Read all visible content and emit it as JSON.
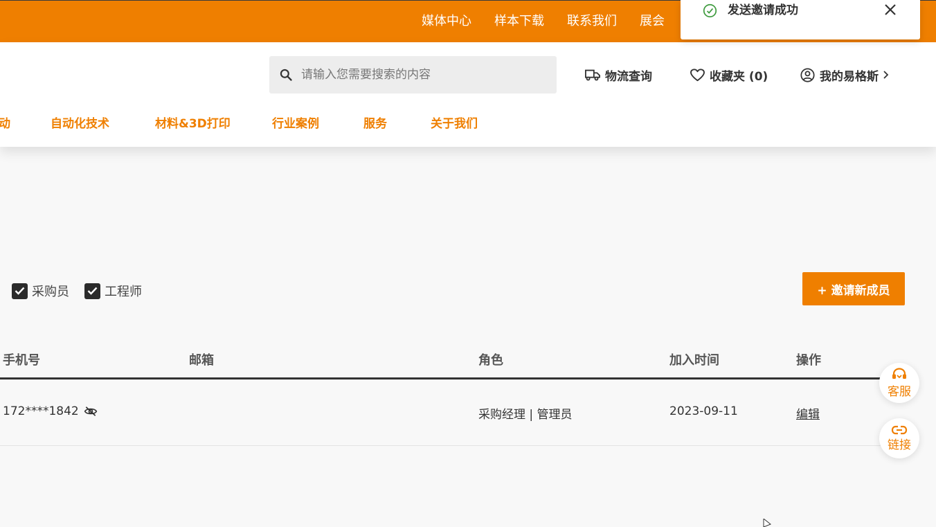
{
  "topbar": {
    "links": [
      "媒体中心",
      "样本下载",
      "联系我们",
      "展会"
    ]
  },
  "toast": {
    "message": "发送邀请成功",
    "icon": "check-circle-icon",
    "close_icon": "close-icon"
  },
  "header": {
    "search": {
      "placeholder": "请输入您需要搜索的内容"
    },
    "logistics_label": "物流查询",
    "favorites_label": "收藏夹 (0)",
    "account_label": "我的易格斯"
  },
  "nav": {
    "items": [
      "动",
      "自动化技术",
      "材料&3D打印",
      "行业案例",
      "服务",
      "关于我们"
    ]
  },
  "filters": {
    "items": [
      {
        "label": "采购员",
        "checked": true
      },
      {
        "label": "工程师",
        "checked": true
      }
    ]
  },
  "invite_button": "+ 邀请新成员",
  "table": {
    "columns": [
      "手机号",
      "邮箱",
      "角色",
      "加入时间",
      "操作"
    ],
    "rows": [
      {
        "phone": "172****1842",
        "email": "",
        "role": "采购经理 | 管理员",
        "joined": "2023-09-11",
        "action": "编辑"
      }
    ]
  },
  "floating": {
    "service_label": "客服",
    "link_label": "链接"
  },
  "colors": {
    "brand_orange": "#ef7f00",
    "text_dark": "#333333",
    "background": "#f8f8f8"
  }
}
